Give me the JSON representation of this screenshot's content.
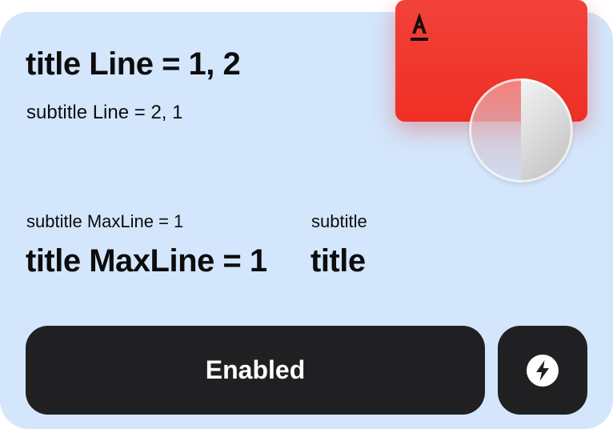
{
  "card": {
    "title_top": "title Line = 1, 2",
    "subtitle_top": "subtitle Line = 2, 1",
    "left_block": {
      "subtitle": "subtitle MaxLine = 1",
      "title": "title MaxLine = 1"
    },
    "right_block": {
      "subtitle": "subtitle",
      "title": "title"
    }
  },
  "decoration": {
    "brand_card_color": "#ef3a30",
    "brand_logo_icon": "alfa-logo-icon",
    "coin_icon": "coin-icon"
  },
  "actions": {
    "primary_label": "Enabled",
    "icon_button_icon": "lightning-bolt-icon"
  },
  "colors": {
    "card_bg": "#d3e6fb",
    "button_bg": "#202023",
    "text": "#0c0c0e"
  }
}
